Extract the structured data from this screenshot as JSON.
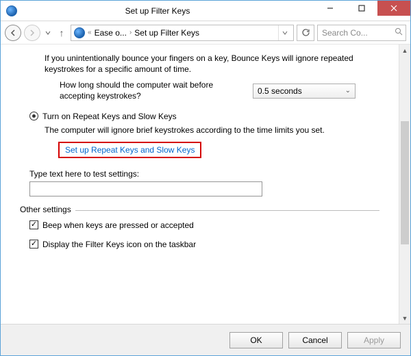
{
  "window": {
    "title": "Set up Filter Keys"
  },
  "nav": {
    "crumb_root": "Ease o...",
    "crumb_page": "Set up Filter Keys",
    "search_placeholder": "Search Co..."
  },
  "bounce": {
    "desc": "If you unintentionally bounce your fingers on a key, Bounce Keys will ignore repeated keystrokes for a specific amount of time.",
    "wait_question": "How long should the computer wait before accepting keystrokes?",
    "wait_value": "0.5 seconds"
  },
  "repeat": {
    "radio_label": "Turn on Repeat Keys and Slow Keys",
    "desc": "The computer will ignore brief keystrokes according to the time limits you set.",
    "link": "Set up Repeat Keys and Slow Keys"
  },
  "test": {
    "label": "Type text here to test settings:",
    "value": ""
  },
  "other": {
    "legend": "Other settings",
    "beep": "Beep when keys are pressed or accepted",
    "taskbar": "Display the Filter Keys icon on the taskbar"
  },
  "buttons": {
    "ok": "OK",
    "cancel": "Cancel",
    "apply": "Apply"
  }
}
